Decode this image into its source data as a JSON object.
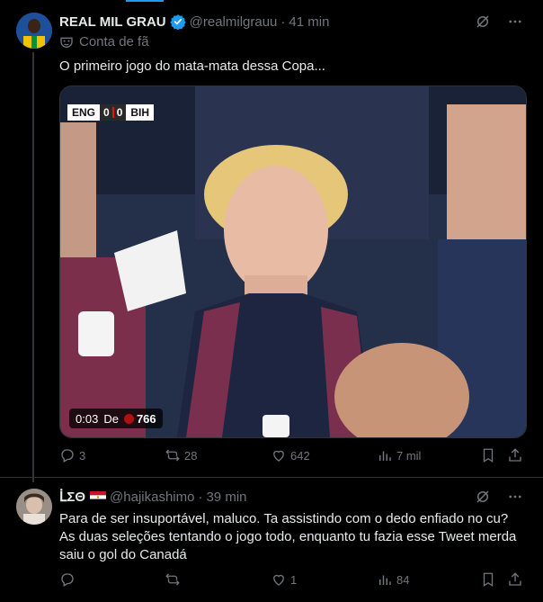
{
  "tweet1": {
    "display_name": "REAL MIL GRAU",
    "handle": "@realmilgrauu",
    "dot": "·",
    "time": "41 min",
    "fan_label": "Conta de fã",
    "text": "O primeiro jogo do mata-mata dessa Copa...",
    "video": {
      "team_home": "ENG",
      "score_home": "0",
      "score_away": "0",
      "team_away": "BIH",
      "timestamp": "0:03",
      "from_label": "De",
      "views": "766"
    },
    "actions": {
      "replies": "3",
      "reposts": "28",
      "likes": "642",
      "views": "7 mil"
    }
  },
  "tweet2": {
    "display_name": "ᒫΣΘ",
    "handle": "@hajikashimo",
    "dot": "·",
    "time": "39 min",
    "text": "Para de ser insuportável, maluco. Ta assistindo com o dedo enfiado no cu? As duas seleções tentando o jogo todo, enquanto tu fazia esse Tweet merda saiu o gol do Canadá",
    "actions": {
      "replies": "",
      "reposts": "",
      "likes": "1",
      "views": "84"
    }
  },
  "colors": {
    "background": "#000000",
    "text": "#e7e9ea",
    "muted": "#71767b",
    "accent": "#1d9bf0",
    "border": "#2f3336"
  },
  "icons": [
    "verified-badge-icon",
    "grok-icon",
    "more-icon",
    "mask-icon",
    "egypt-flag-icon",
    "reply-icon",
    "repost-icon",
    "like-icon",
    "views-icon",
    "bookmark-icon",
    "share-icon"
  ]
}
